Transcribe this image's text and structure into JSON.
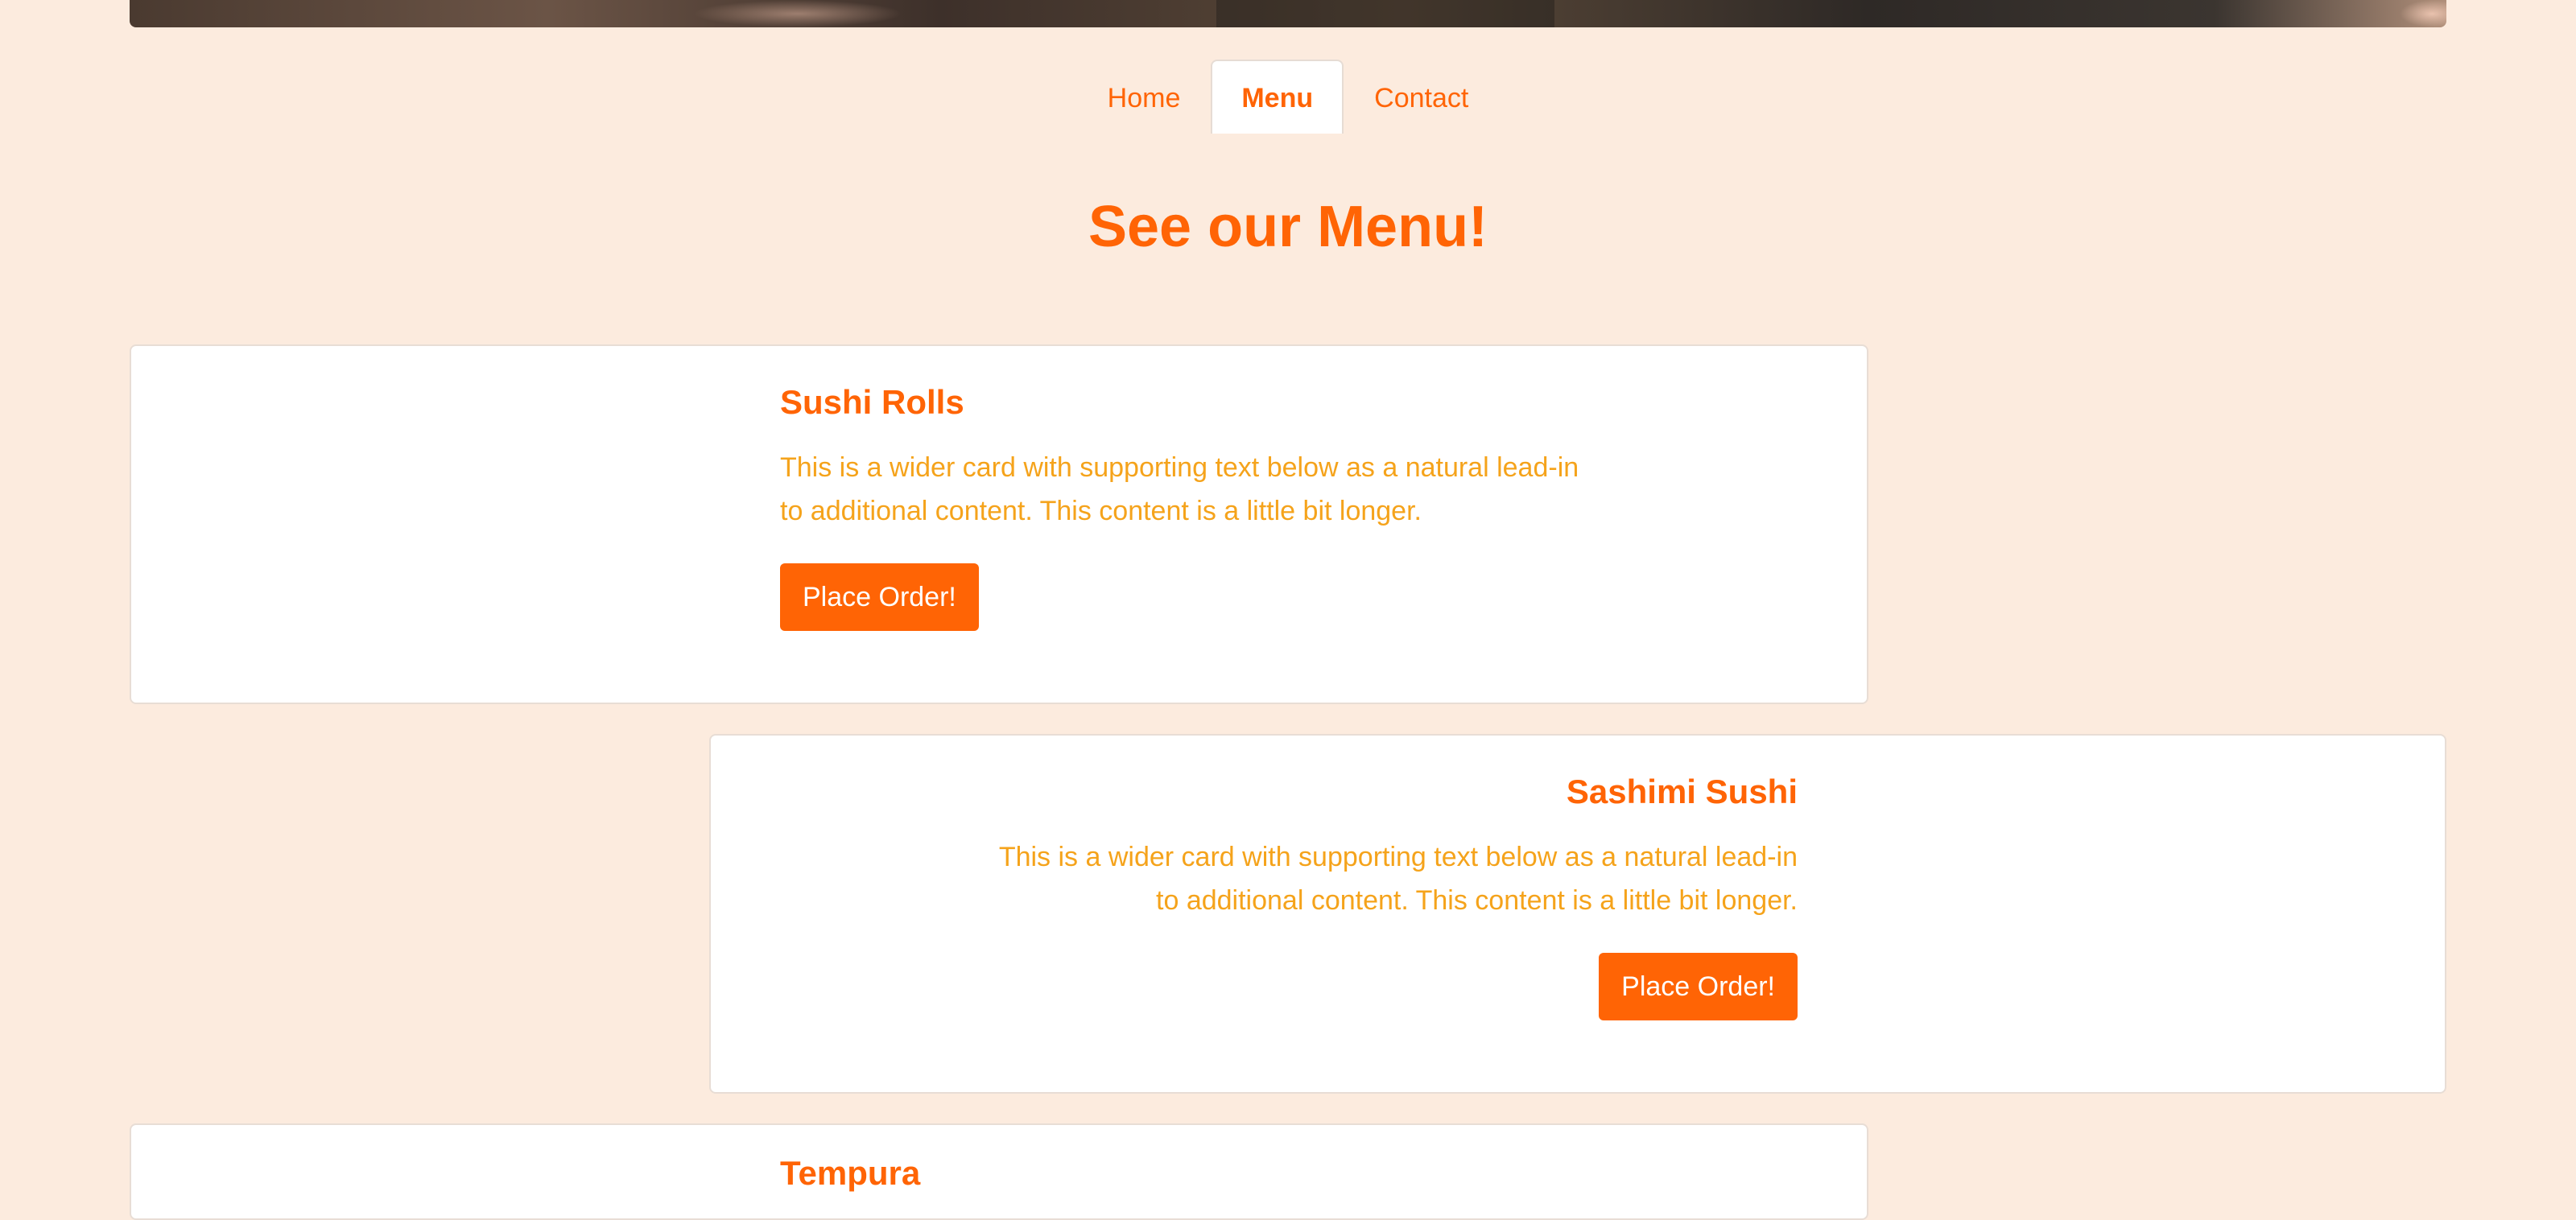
{
  "nav": {
    "items": [
      {
        "label": "Home",
        "active": false
      },
      {
        "label": "Menu",
        "active": true
      },
      {
        "label": "Contact",
        "active": false
      }
    ]
  },
  "page": {
    "title": "See our Menu!"
  },
  "menu": {
    "cards": [
      {
        "title": "Sushi Rolls",
        "text": "This is a wider card with supporting text below as a natural lead-in to additional content. This content is a little bit longer.",
        "button": "Place Order!"
      },
      {
        "title": "Sashimi Sushi",
        "text": "This is a wider card with supporting text below as a natural lead-in to additional content. This content is a little bit longer.",
        "button": "Place Order!"
      },
      {
        "title": "Tempura",
        "text": "",
        "button": ""
      }
    ]
  },
  "colors": {
    "background": "#fcebde",
    "accent": "#ff6405",
    "secondary_text": "#f5a31b",
    "card": "#ffffff"
  }
}
